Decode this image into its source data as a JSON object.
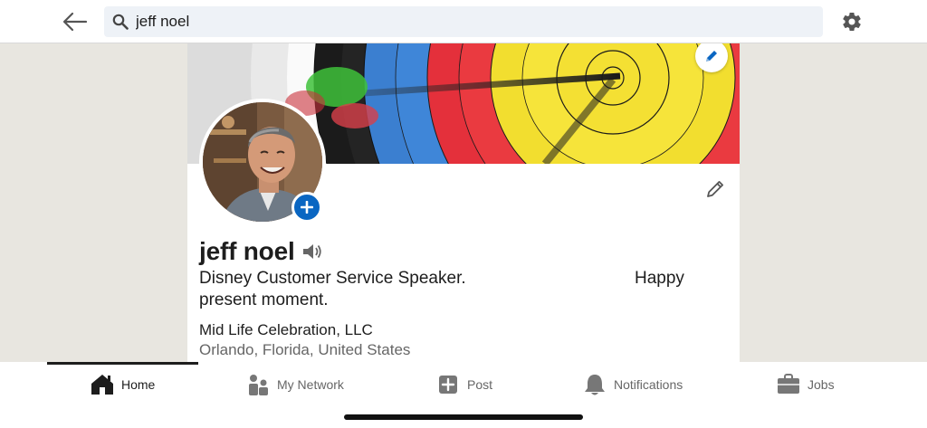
{
  "search": {
    "query": "jeff noel"
  },
  "profile": {
    "name": "jeff noel",
    "headline_part1": "Disney Customer Service Speaker.",
    "headline_part2": "Happy",
    "headline_part3": "present moment.",
    "company": "Mid Life Celebration, LLC",
    "location": "Orlando, Florida, United States"
  },
  "nav": {
    "items": [
      {
        "label": "Home",
        "icon": "home-icon"
      },
      {
        "label": "My Network",
        "icon": "network-icon"
      },
      {
        "label": "Post",
        "icon": "post-icon"
      },
      {
        "label": "Notifications",
        "icon": "bell-icon"
      },
      {
        "label": "Jobs",
        "icon": "briefcase-icon"
      }
    ]
  },
  "colors": {
    "accent": "#0a66c2",
    "background": "#e8e6e0",
    "nav_active": "#1d1d1d",
    "nav_inactive": "#666666"
  }
}
